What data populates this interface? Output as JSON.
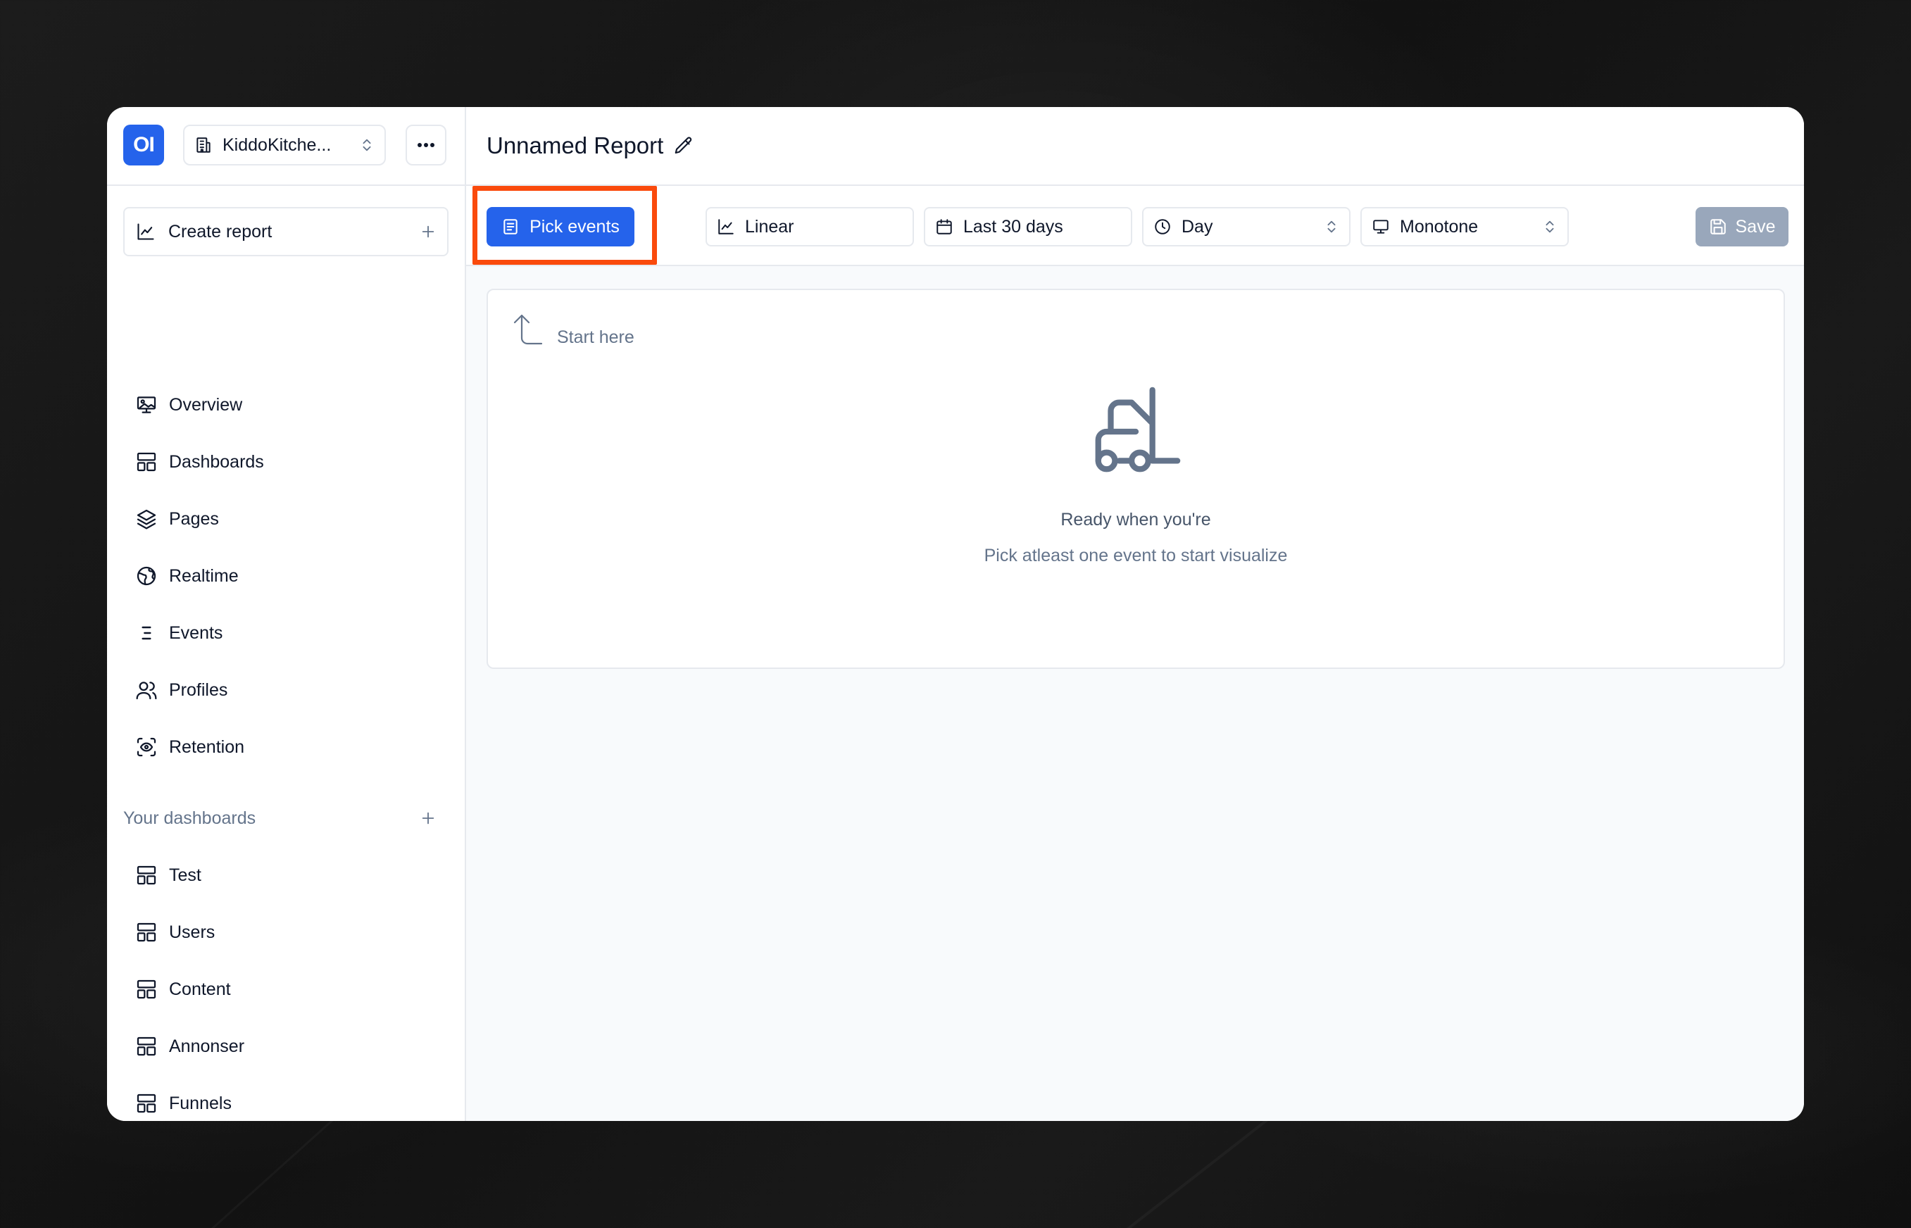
{
  "app": {
    "logo_text": "OI",
    "project_name": "KiddoKitche..."
  },
  "sidebar": {
    "create_report_label": "Create report",
    "nav_items": [
      {
        "label": "Overview",
        "icon": "presentation-icon"
      },
      {
        "label": "Dashboards",
        "icon": "layout-icon"
      },
      {
        "label": "Pages",
        "icon": "layers-icon"
      },
      {
        "label": "Realtime",
        "icon": "globe-icon"
      },
      {
        "label": "Events",
        "icon": "list-icon"
      },
      {
        "label": "Profiles",
        "icon": "users-icon"
      },
      {
        "label": "Retention",
        "icon": "scan-eye-icon"
      }
    ],
    "dashboards_section_title": "Your dashboards",
    "dashboards": [
      {
        "label": "Test",
        "icon": "layout-icon"
      },
      {
        "label": "Users",
        "icon": "layout-icon"
      },
      {
        "label": "Content",
        "icon": "layout-icon"
      },
      {
        "label": "Annonser",
        "icon": "layout-icon"
      },
      {
        "label": "Funnels",
        "icon": "layout-icon"
      }
    ]
  },
  "header": {
    "report_title": "Unnamed Report"
  },
  "toolbar": {
    "pick_events_label": "Pick events",
    "chart_type": "Linear",
    "date_range": "Last 30 days",
    "interval": "Day",
    "color_scheme": "Monotone",
    "save_label": "Save"
  },
  "content": {
    "start_here": "Start here",
    "empty_title": "Ready when you're",
    "empty_subtitle": "Pick atleast one event to start visualize"
  },
  "colors": {
    "accent": "#2563eb",
    "highlight": "#fa4a0c",
    "save_disabled": "#94a3b8"
  }
}
